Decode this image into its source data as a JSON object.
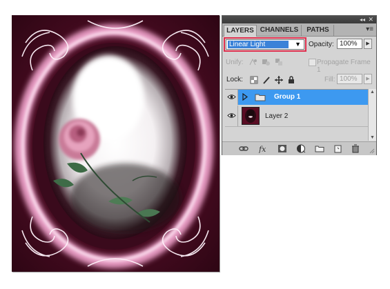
{
  "artwork": {
    "layer": "Layer 2"
  },
  "panel": {
    "tabs": [
      {
        "label": "LAYERS",
        "active": true
      },
      {
        "label": "CHANNELS",
        "active": false
      },
      {
        "label": "PATHS",
        "active": false
      }
    ],
    "titlebar": {
      "collapse_icon": "double-chevron-icon",
      "close_icon": "close-icon"
    },
    "menu_icon": "panel-menu-icon",
    "blend_mode": "Linear Light",
    "opacity_label": "Opacity:",
    "opacity_value": "100%",
    "unify_label": "Unify:",
    "propagate_label": "Propagate Frame 1",
    "lock_label": "Lock:",
    "fill_label": "Fill:",
    "fill_value": "100%",
    "layers": [
      {
        "name": "Group 1",
        "type": "group",
        "selected": true,
        "visible": true,
        "expanded": false
      },
      {
        "name": "Layer 2",
        "type": "layer",
        "selected": false,
        "visible": true
      }
    ],
    "footer_icons": [
      "link-layers-icon",
      "fx-icon",
      "add-mask-icon",
      "adjustment-layer-icon",
      "new-group-icon",
      "new-layer-icon",
      "trash-icon"
    ]
  },
  "colors": {
    "selection": "#3d99f0",
    "highlight_border": "#e0304e",
    "blend_selected": "#3b82d8"
  }
}
